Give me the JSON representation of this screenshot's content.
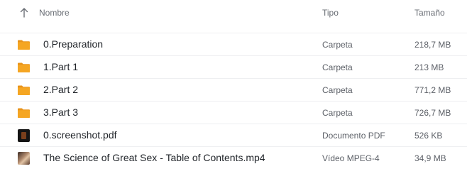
{
  "header": {
    "name_label": "Nombre",
    "type_label": "Tipo",
    "size_label": "Tamaño",
    "sort_icon": "arrow-up-icon"
  },
  "colors": {
    "folder": "#F5A623",
    "folder_tab": "#E8931A",
    "divider": "#EEEFF1"
  },
  "rows": [
    {
      "icon": "folder-icon",
      "name": "0.Preparation",
      "type": "Carpeta",
      "size": "218,7 MB"
    },
    {
      "icon": "folder-icon",
      "name": "1.Part 1",
      "type": "Carpeta",
      "size": "213 MB"
    },
    {
      "icon": "folder-icon",
      "name": "2.Part 2",
      "type": "Carpeta",
      "size": "771,2 MB"
    },
    {
      "icon": "folder-icon",
      "name": "3.Part 3",
      "type": "Carpeta",
      "size": "726,7 MB"
    },
    {
      "icon": "pdf-thumbnail",
      "name": "0.screenshot.pdf",
      "type": "Documento PDF",
      "size": "526 KB"
    },
    {
      "icon": "video-thumbnail",
      "name": "The Science of Great Sex - Table of Contents.mp4",
      "type": "Vídeo MPEG-4",
      "size": "34,9 MB"
    }
  ]
}
